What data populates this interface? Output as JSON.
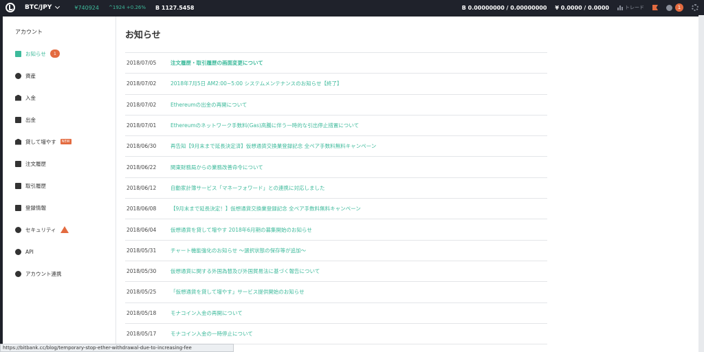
{
  "topbar": {
    "pair": "BTC/JPY",
    "price": "¥740924",
    "change": "^1924 +0.26%",
    "btc_price": "B 1127.5458",
    "btc_balance": "B 0.00000000 / 0.00000000",
    "jpy_balance": "¥ 0.0000 / 0.0000",
    "trade_label": "トレード",
    "notify_count": "1"
  },
  "sidebar": {
    "title": "アカウント",
    "items": [
      {
        "label": "お知らせ",
        "badge": "1"
      },
      {
        "label": "資産"
      },
      {
        "label": "入金"
      },
      {
        "label": "出金"
      },
      {
        "label": "貸して増やす",
        "tag": "NEW"
      },
      {
        "label": "注文履歴"
      },
      {
        "label": "取引履歴"
      },
      {
        "label": "登録情報"
      },
      {
        "label": "セキュリティ"
      },
      {
        "label": "API"
      },
      {
        "label": "アカウント連携"
      }
    ]
  },
  "main": {
    "title": "お知らせ",
    "news": [
      {
        "date": "2018/07/05",
        "title": "注文履歴・取引履歴の画面変更について",
        "bold": true
      },
      {
        "date": "2018/07/02",
        "title": "2018年7月5日 AM2:00~5:00 システムメンテナンスのお知らせ【終了】"
      },
      {
        "date": "2018/07/02",
        "title": "Ethereumの出金の再開について"
      },
      {
        "date": "2018/07/01",
        "title": "Ethereumのネットワーク手数料(Gas)高騰に伴う一時的な引出停止措置について"
      },
      {
        "date": "2018/06/30",
        "title": "再告知【9月末まで延長決定済】仮想通貨交換業登録記念 全ペア手数料無料キャンペーン"
      },
      {
        "date": "2018/06/22",
        "title": "関東財務局からの業務改善命令について"
      },
      {
        "date": "2018/06/12",
        "title": "自動家計簿サービス「マネーフォワード」との連携に対応しました"
      },
      {
        "date": "2018/06/08",
        "title": "【9月末まで延長決定！】仮想通貨交換業登録記念 全ペア手数料無料キャンペーン"
      },
      {
        "date": "2018/06/04",
        "title": "仮想通貨を貸して増やす 2018年6月期の募集開始のお知らせ"
      },
      {
        "date": "2018/05/31",
        "title": "チャート機能強化のお知らせ ～選択状態の保存等が追加～"
      },
      {
        "date": "2018/05/30",
        "title": "仮想通貨に関する外国為替及び外国貿易法に基づく報告について"
      },
      {
        "date": "2018/05/25",
        "title": "「仮想通貨を貸して増やす」サービス提供開始のお知らせ"
      },
      {
        "date": "2018/05/18",
        "title": "モナコイン入金の再開について"
      },
      {
        "date": "2018/05/17",
        "title": "モナコイン入金の一時停止について"
      }
    ]
  },
  "statusbar": {
    "url": "https://bitbank.cc/blog/temporary-stop-ether-withdrawal-due-to-increasing-fee"
  }
}
